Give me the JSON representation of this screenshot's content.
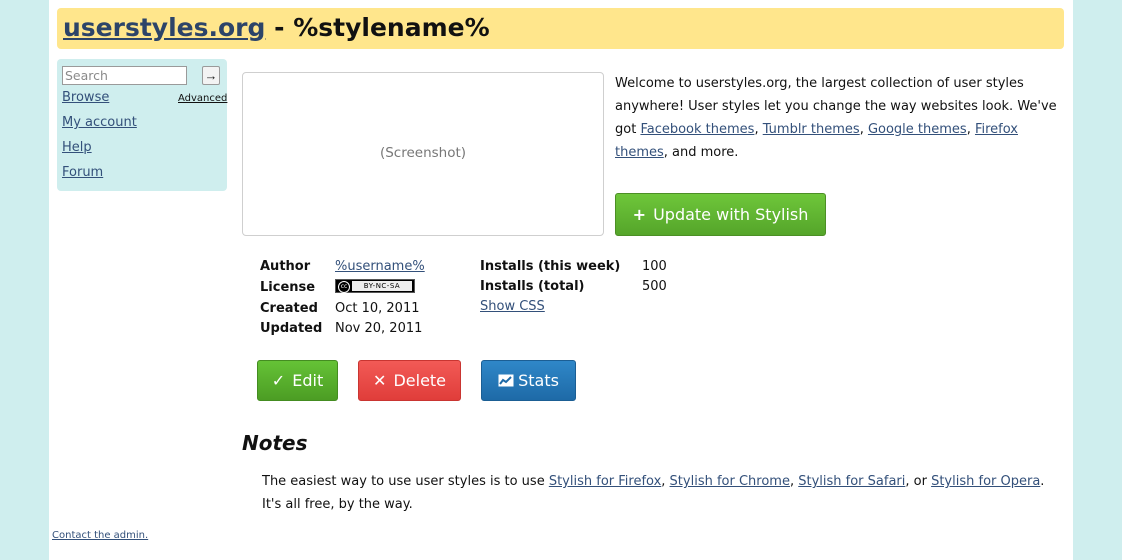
{
  "header": {
    "site_link": "userstyles.org",
    "separator": " - ",
    "style_name": "%stylename%"
  },
  "sidebar": {
    "search_placeholder": "Search",
    "search_go": "→",
    "advanced": "Advanced",
    "links": [
      "Browse",
      "My account",
      "Help",
      "Forum"
    ]
  },
  "screenshot": {
    "placeholder": "(Screenshot)"
  },
  "welcome": {
    "intro": "Welcome to userstyles.org, the largest collection of user styles anywhere! User styles let you change the way websites look. We've got ",
    "link_facebook": "Facebook themes",
    "sep1": ", ",
    "link_tumblr": "Tumblr themes",
    "sep2": ", ",
    "link_google": "Google themes",
    "sep3": ", ",
    "link_firefox": "Firefox themes",
    "outro": ", and more."
  },
  "install_button": {
    "icon": "+",
    "label": "Update with Stylish"
  },
  "details": {
    "author_label": "Author",
    "author_value": "%username%",
    "license_label": "License",
    "license_badge": "BY-NC-SA",
    "license_cc": "cc",
    "created_label": "Created",
    "created_value": "Oct 10, 2011",
    "updated_label": "Updated",
    "updated_value": "Nov 20, 2011",
    "installs_week_label": "Installs (this week)",
    "installs_week_value": "100",
    "installs_total_label": "Installs (total)",
    "installs_total_value": "500",
    "show_css": "Show CSS"
  },
  "actions": {
    "edit_icon": "✓",
    "edit": "Edit",
    "delete_icon": "✕",
    "delete": "Delete",
    "stats": "Stats"
  },
  "notes": {
    "title": "Notes",
    "text_start": "The easiest way to use user styles is to use ",
    "link_firefox": "Stylish for Firefox",
    "sep1": ", ",
    "link_chrome": "Stylish for Chrome",
    "sep2": ", ",
    "link_safari": "Stylish for Safari",
    "sep3": ", or ",
    "link_opera": "Stylish for Opera",
    "text_end": ". It's all free, by the way."
  },
  "footer": {
    "contact": "Contact the admin."
  },
  "colors": {
    "background": "#cfeeee",
    "header_bg": "#ffe68c",
    "link": "#33507a",
    "green": "#5cb130",
    "red": "#e94a47",
    "blue": "#2577b8"
  }
}
